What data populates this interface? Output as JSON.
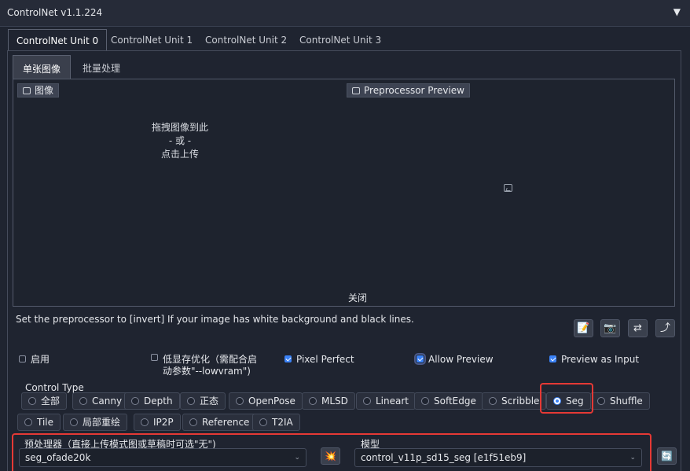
{
  "header": {
    "title": "ControlNet v1.1.224",
    "toggle_icon": "▼"
  },
  "unit_tabs": [
    "ControlNet Unit 0",
    "ControlNet Unit 1",
    "ControlNet Unit 2",
    "ControlNet Unit 3"
  ],
  "mode_tabs": [
    "单张图像",
    "批量处理"
  ],
  "image_panel": {
    "image_label": "图像",
    "drop_line1": "拖拽图像到此",
    "drop_line2": "- 或 -",
    "drop_line3": "点击上传",
    "preview_label": "Preprocessor Preview",
    "close_label": "关闭"
  },
  "hint": "Set the preprocessor to [invert] If your image has white background and black lines.",
  "tool_buttons": [
    {
      "icon": "edit-icon",
      "glyph": "📝"
    },
    {
      "icon": "camera-icon",
      "glyph": "📷"
    },
    {
      "icon": "swap-icon",
      "glyph": "⇄"
    },
    {
      "icon": "send-up-icon",
      "glyph": "⤴"
    }
  ],
  "options": {
    "enable": {
      "label": "启用",
      "checked": false
    },
    "lowvram": {
      "label_line1": "低显存优化（需配合启",
      "label_line2": "动参数\"--lowvram\")",
      "checked": false
    },
    "pixel_perfect": {
      "label": "Pixel Perfect",
      "checked": true
    },
    "allow_preview": {
      "label": "Allow Preview",
      "checked": true
    },
    "preview_as_input": {
      "label": "Preview as Input",
      "checked": true
    }
  },
  "control_type": {
    "label": "Control Type",
    "row1": [
      "全部",
      "Canny",
      "Depth",
      "正态",
      "OpenPose",
      "MLSD",
      "Lineart",
      "SoftEdge",
      "Scribble",
      "Seg",
      "Shuffle"
    ],
    "row2": [
      "Tile",
      "局部重绘",
      "IP2P",
      "Reference",
      "T2IA"
    ],
    "selected": "Seg"
  },
  "preprocessor": {
    "label": "预处理器（直接上传模式图或草稿时可选\"无\")",
    "value": "seg_ofade20k"
  },
  "run_button": {
    "icon": "explosion-icon",
    "glyph": "💥"
  },
  "model": {
    "label": "模型",
    "value": "control_v11p_sd15_seg [e1f51eb9]"
  },
  "refresh_button": {
    "icon": "refresh-icon",
    "glyph": "🔄"
  },
  "colors": {
    "accent": "#3b82f6",
    "highlight": "#e53935",
    "background": "#1f2430"
  }
}
